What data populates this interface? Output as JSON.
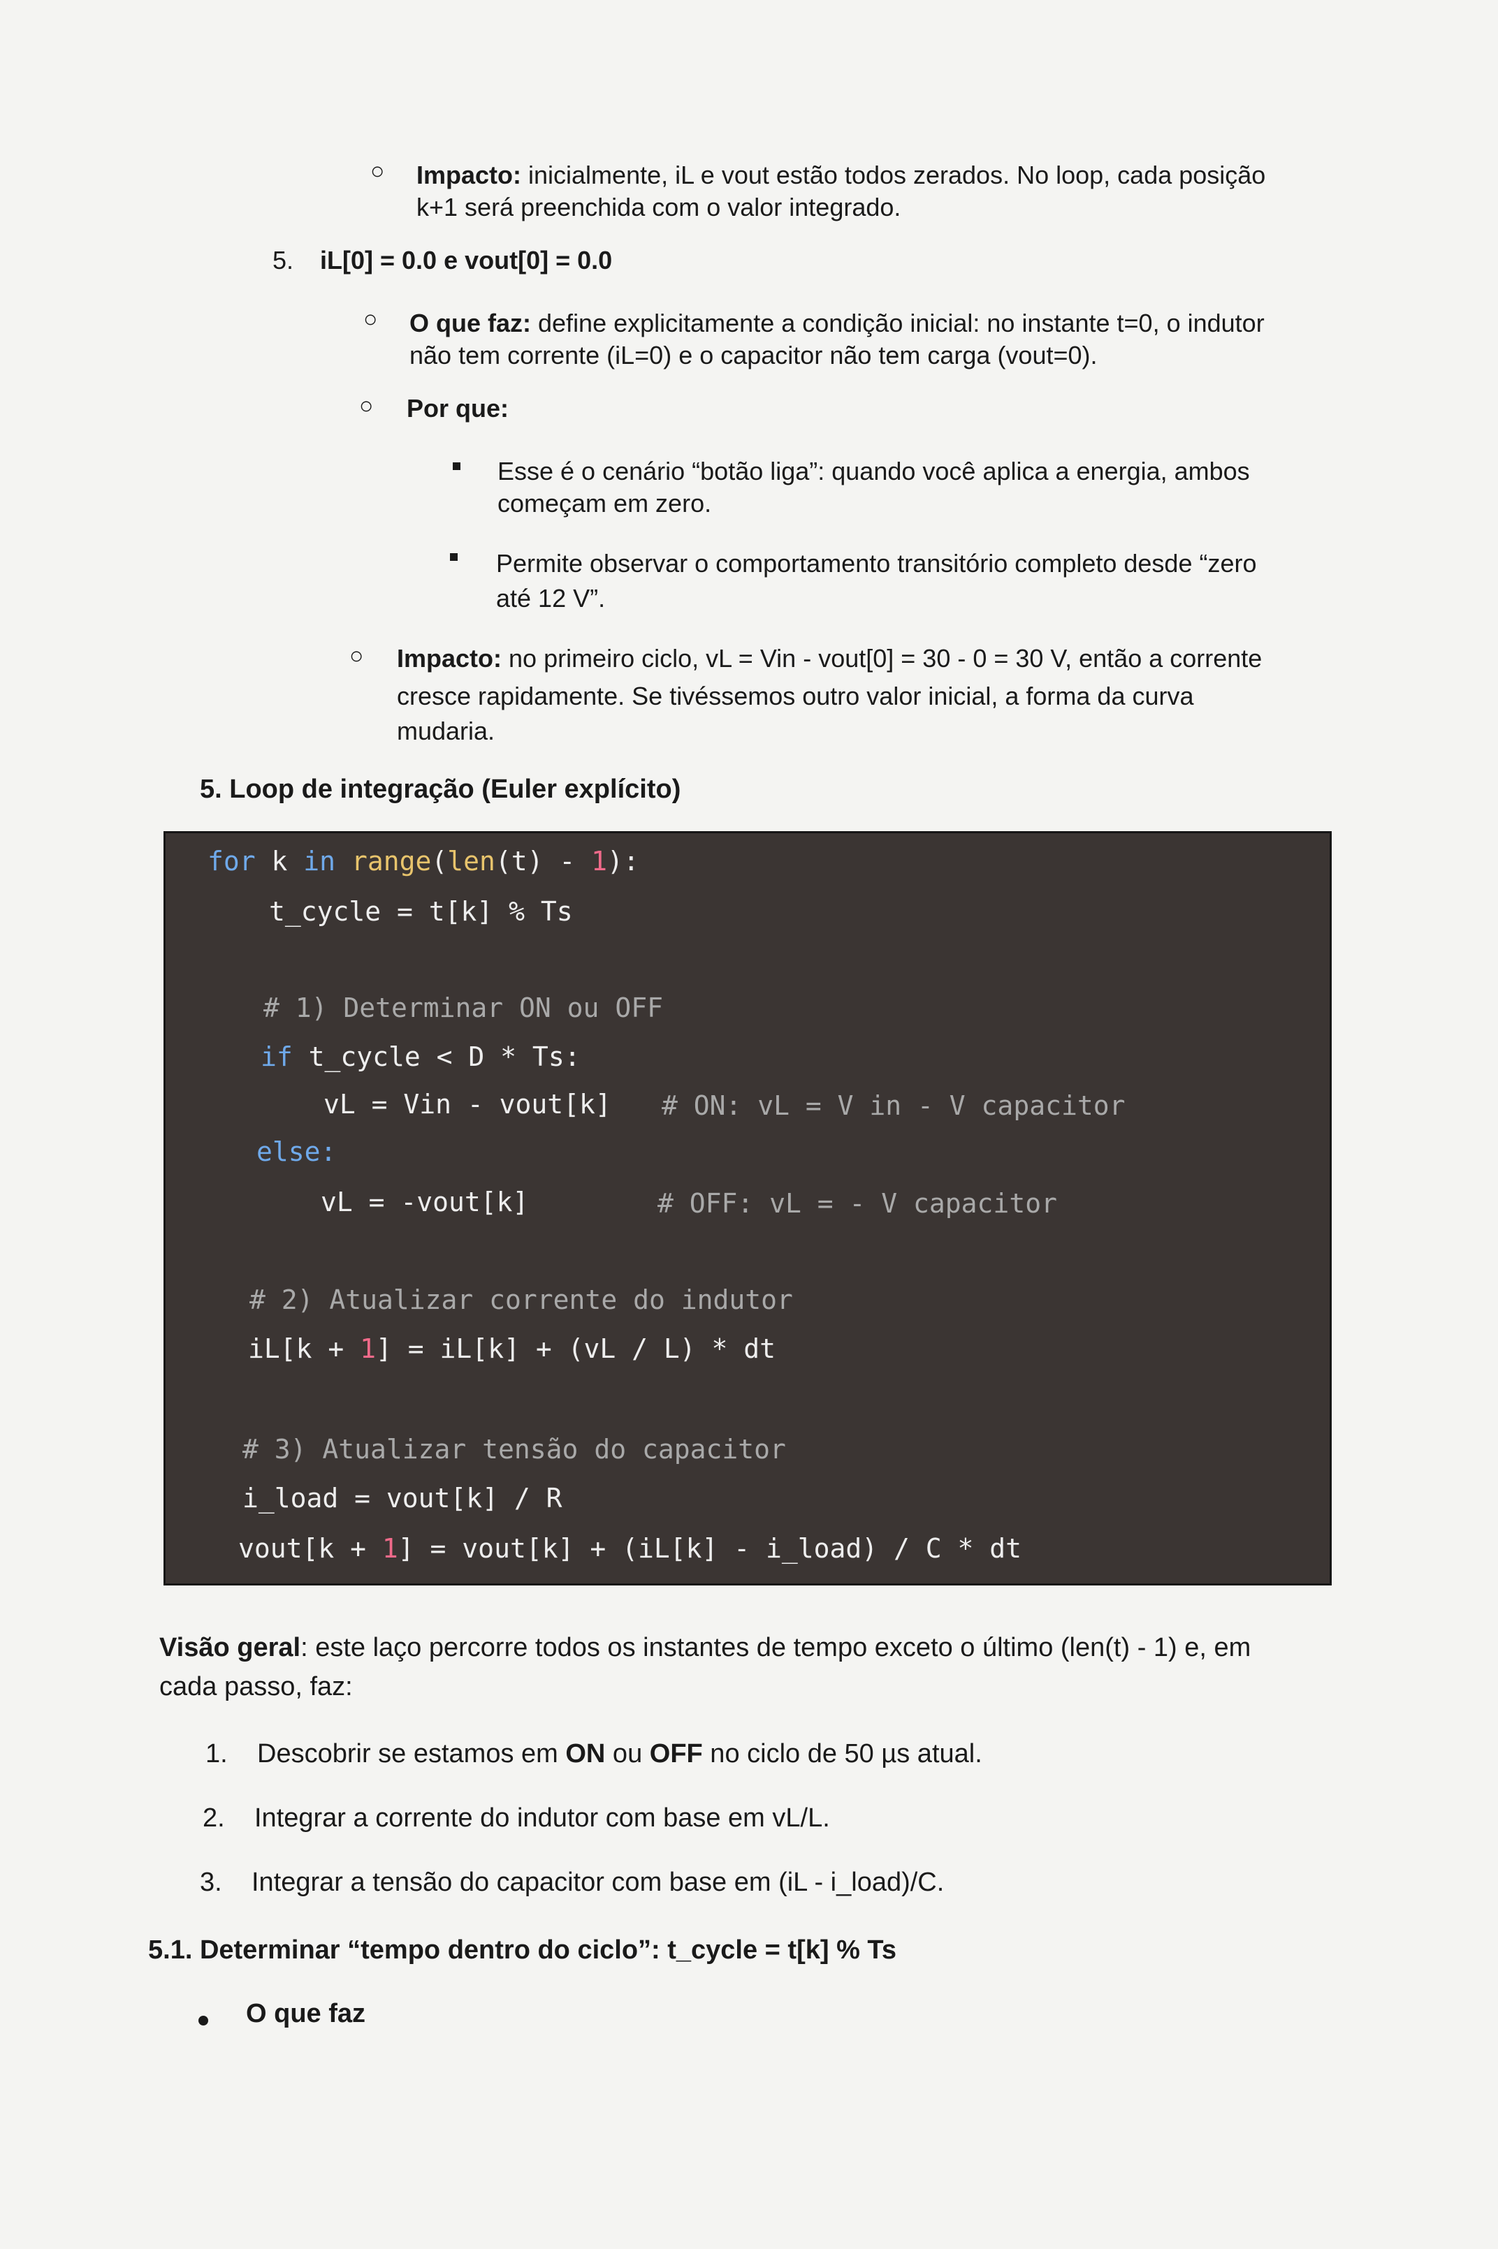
{
  "section4_tail": {
    "impacto_label": "Impacto:",
    "impacto_line1": " inicialmente, iL e vout estão todos zerados. No loop, cada posição",
    "impacto_line2": "k+1 será preenchida com o valor integrado."
  },
  "item5": {
    "number": "5.",
    "title": "iL[0] = 0.0 e vout[0] = 0.0",
    "oque_label": "O que faz:",
    "oque_line1": " define explicitamente a condição inicial: no instante t=0, o indutor",
    "oque_line2": "não tem corrente (iL=0) e o capacitor não tem carga (vout=0).",
    "porque_label": "Por que:",
    "bullet1_line1": "Esse é o cenário “botão liga”: quando você aplica a energia, ambos",
    "bullet1_line2": "começam em zero.",
    "bullet2_line1": "Permite observar o comportamento transitório completo desde “zero",
    "bullet2_line2": "até 12 V”.",
    "impacto_label": "Impacto:",
    "impacto_line1": " no primeiro ciclo, vL = Vin - vout[0] = 30 - 0 = 30 V, então a corrente",
    "impacto_line2": "cresce rapidamente. Se tivéssemos outro valor inicial, a forma da curva",
    "impacto_line3": "mudaria."
  },
  "section5": {
    "heading": "5. Loop de integração (Euler explícito)"
  },
  "code": {
    "l1_for": "for",
    "l1_k": " k ",
    "l1_in": "in",
    "l1_sp": " ",
    "l1_range": "range",
    "l1_open": "(",
    "l1_len": "len",
    "l1_mid": "(t) - ",
    "l1_one": "1",
    "l1_end": "):",
    "l2": "t_cycle = t[k] % Ts",
    "l3": "# 1) Determinar ON ou OFF",
    "l4_if": "if",
    "l4_rest": " t_cycle < D * Ts:",
    "l5_code": "vL = Vin - vout[k]",
    "l5_cm": "# ON: vL = V in - V capacitor",
    "l6": "else:",
    "l7_code": "vL = -vout[k]",
    "l7_cm": "# OFF: vL = - V capacitor",
    "l8": "# 2) Atualizar corrente do indutor",
    "l9_a": "iL[k + ",
    "l9_one": "1",
    "l9_b": "] = iL[k] + (vL / L) * dt",
    "l10": "# 3) Atualizar tensão do capacitor",
    "l11": "i_load = vout[k] / R",
    "l12_a": "vout[k + ",
    "l12_one": "1",
    "l12_b": "] = vout[k] + (iL[k] - i_load) / C * dt"
  },
  "overview": {
    "label": "Visão geral",
    "line1": ": este laço percorre todos os instantes de tempo exceto o último (len(t) - 1) e, em",
    "line2": "cada passo, faz:"
  },
  "steps": [
    {
      "num": "1.",
      "pre": "Descobrir se estamos em ",
      "on": "ON",
      "mid": " ou ",
      "off": "OFF",
      "post": " no ciclo de 50 µs atual."
    },
    {
      "num": "2.",
      "text": "Integrar a corrente do indutor com base em vL/L."
    },
    {
      "num": "3.",
      "text": "Integrar a tensão do capacitor com base em (iL - i_load)/C."
    }
  ],
  "sub51": {
    "heading": "5.1. Determinar “tempo dentro do ciclo”: t_cycle = t[k] % Ts",
    "bullet": "O que faz"
  }
}
